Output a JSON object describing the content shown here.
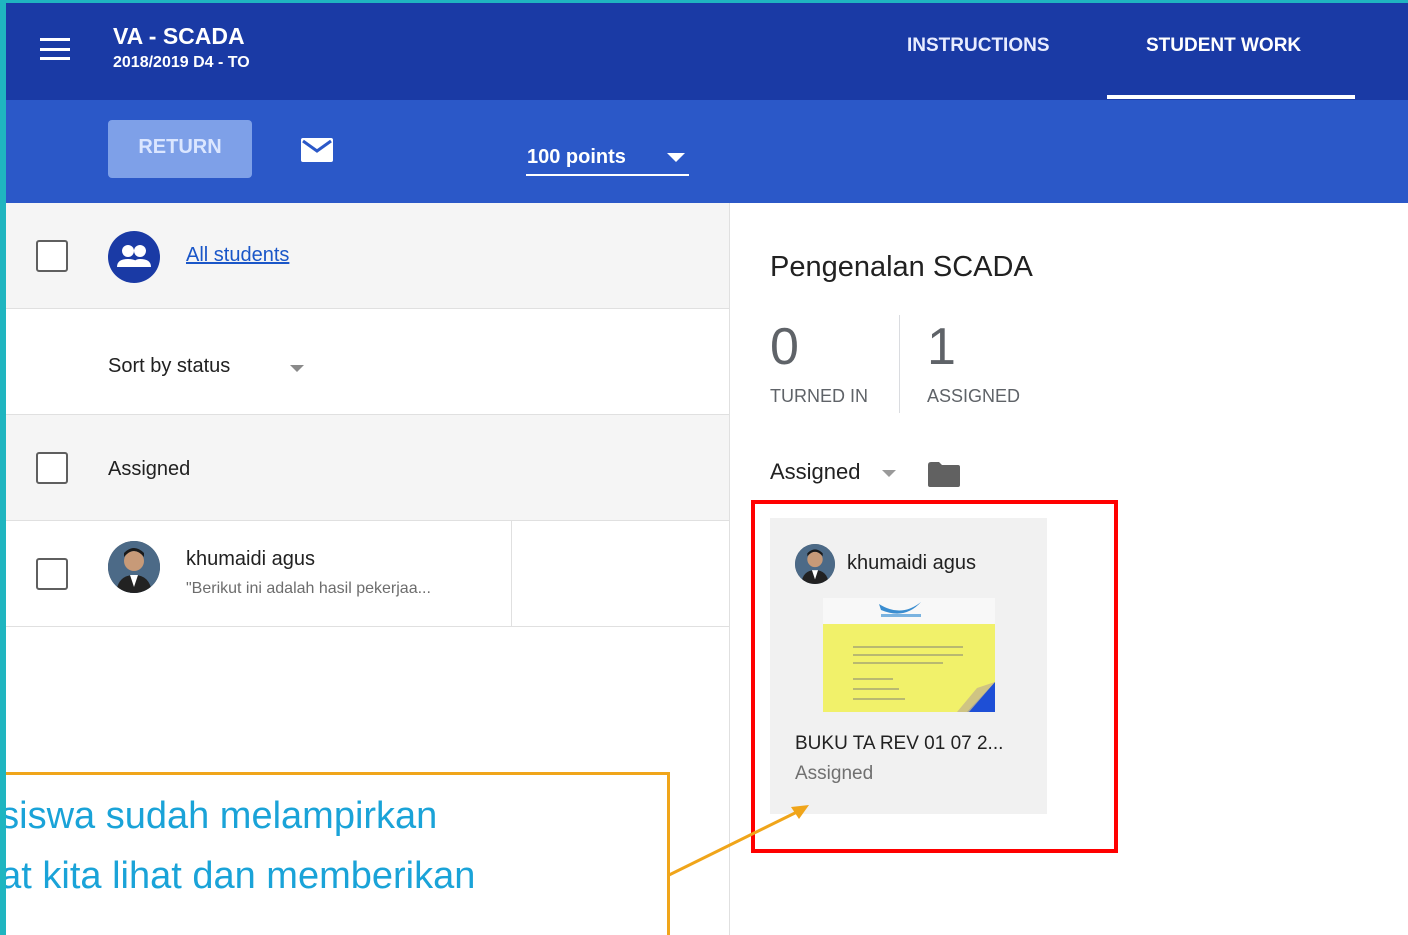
{
  "header": {
    "class_name": "VA - SCADA",
    "class_section": "2018/2019 D4 - TO",
    "tabs": [
      {
        "label": "INSTRUCTIONS",
        "active": false
      },
      {
        "label": "STUDENT WORK",
        "active": true
      }
    ],
    "colors": {
      "app_bar": "#1a3aa5",
      "action_bar": "#2b58c8"
    }
  },
  "toolbar": {
    "return_label": "RETURN",
    "mail_icon": "mail-icon",
    "points_value": "100 points"
  },
  "roster": {
    "all_students_label": "All students",
    "sort_label": "Sort by status",
    "group_heading": "Assigned",
    "students": [
      {
        "name": "khumaidi agus",
        "comment": "\"Berikut ini adalah hasil pekerjaa..."
      }
    ]
  },
  "assignment": {
    "title": "Pengenalan SCADA",
    "turned_in_count": "0",
    "turned_in_label": "TURNED IN",
    "assigned_count": "1",
    "assigned_label": "ASSIGNED",
    "filter_value": "Assigned",
    "folder_icon": "folder-icon"
  },
  "work_card": {
    "student_name": "khumaidi agus",
    "file_name": "BUKU TA REV 01 07 2...",
    "status": "Assigned",
    "highlight_color": "#ff0000"
  },
  "callout": {
    "line1": "asiswa sudah melampirkan",
    "line2": "pat kita lihat dan memberikan",
    "border_color": "#f0a51a",
    "text_color": "#1aa3d8"
  }
}
